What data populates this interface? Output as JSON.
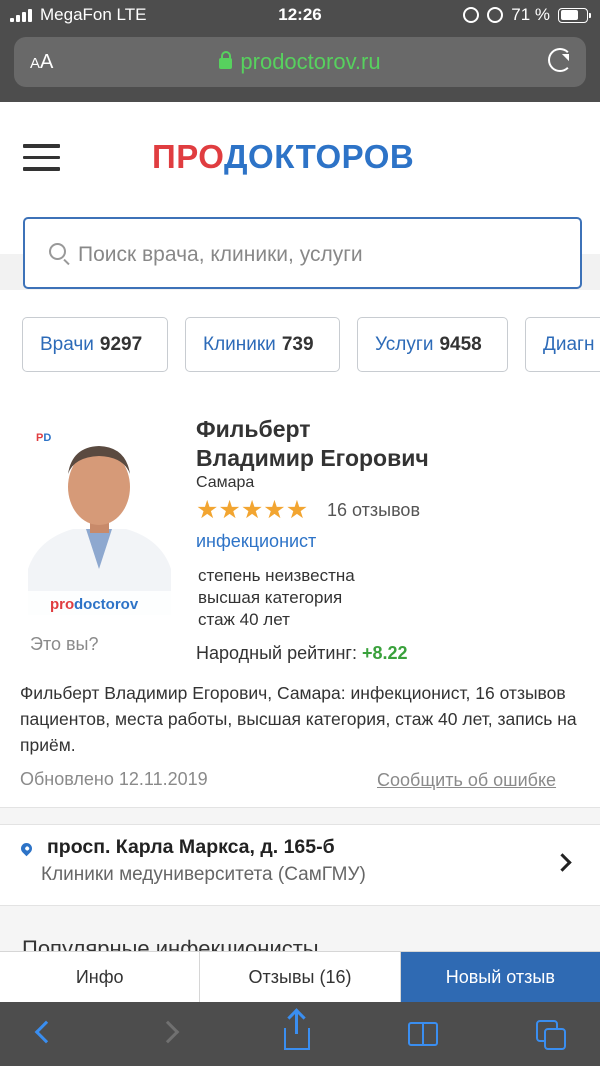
{
  "status_bar": {
    "carrier": "MegaFon LTE",
    "time": "12:26",
    "battery": "71 %"
  },
  "browser": {
    "text_size_label": "AA",
    "url": "prodoctorov.ru"
  },
  "header": {
    "logo_part1": "ПРО",
    "logo_part2": "ДОКТОРОВ"
  },
  "search": {
    "placeholder": "Поиск врача, клиники, услуги"
  },
  "categories": [
    {
      "label": "Врачи",
      "count": "9297"
    },
    {
      "label": "Клиники",
      "count": "739"
    },
    {
      "label": "Услуги",
      "count": "9458"
    },
    {
      "label": "Диагн",
      "count": ""
    }
  ],
  "doctor": {
    "photo_brand_pro": "pro",
    "photo_brand_rest": "doctorov",
    "badge": "PD",
    "its_you": "Это вы?",
    "name_line1": "Фильберт",
    "name_line2": "Владимир Егорович",
    "city": "Самара",
    "stars": 5,
    "reviews": "16 отзывов",
    "specialty": "инфекционист",
    "degree": "степень неизвестна",
    "category": "высшая категория",
    "experience": "стаж 40 лет",
    "rating_label": "Народный рейтинг:",
    "rating_value": "+8.22",
    "description": "Фильберт Владимир Егорович, Самара: инфекционист, 16 отзывов пациентов, места работы, высшая категория, стаж 40 лет, запись на приём.",
    "updated": "Обновлено 12.11.2019",
    "report_error": "Сообщить об ошибке"
  },
  "address": {
    "street": "просп. Карла Маркса, д. 165-б",
    "clinic": "Клиники медуниверситета (СамГМУ)"
  },
  "next_section": "Популярные инфекционисты",
  "tabs": [
    {
      "label": "Инфо"
    },
    {
      "label": "Отзывы (16)"
    },
    {
      "label": "Новый отзыв"
    }
  ],
  "colors": {
    "brand_red": "#e03d40",
    "brand_blue": "#2d73c7",
    "rating_green": "#3aa13c",
    "star": "#f2a531",
    "active_tab": "#2f6ab3"
  }
}
